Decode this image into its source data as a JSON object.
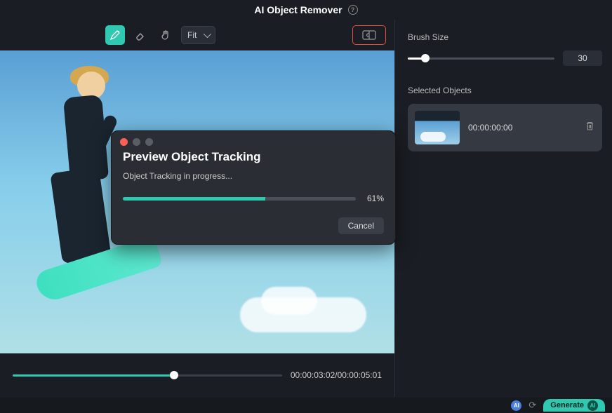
{
  "header": {
    "title": "AI Object Remover"
  },
  "toolbar": {
    "fit_label": "Fit"
  },
  "timeline": {
    "current": "00:00:03:02",
    "total": "00:00:05:01"
  },
  "right_panel": {
    "brush_label": "Brush Size",
    "brush_value": "30",
    "selected_label": "Selected Objects",
    "objects": [
      {
        "time": "00:00:00:00"
      }
    ]
  },
  "modal": {
    "title": "Preview Object Tracking",
    "status": "Object Tracking in progress...",
    "percent": "61%",
    "cancel": "Cancel"
  },
  "footer": {
    "generate": "Generate",
    "ai": "AI"
  }
}
